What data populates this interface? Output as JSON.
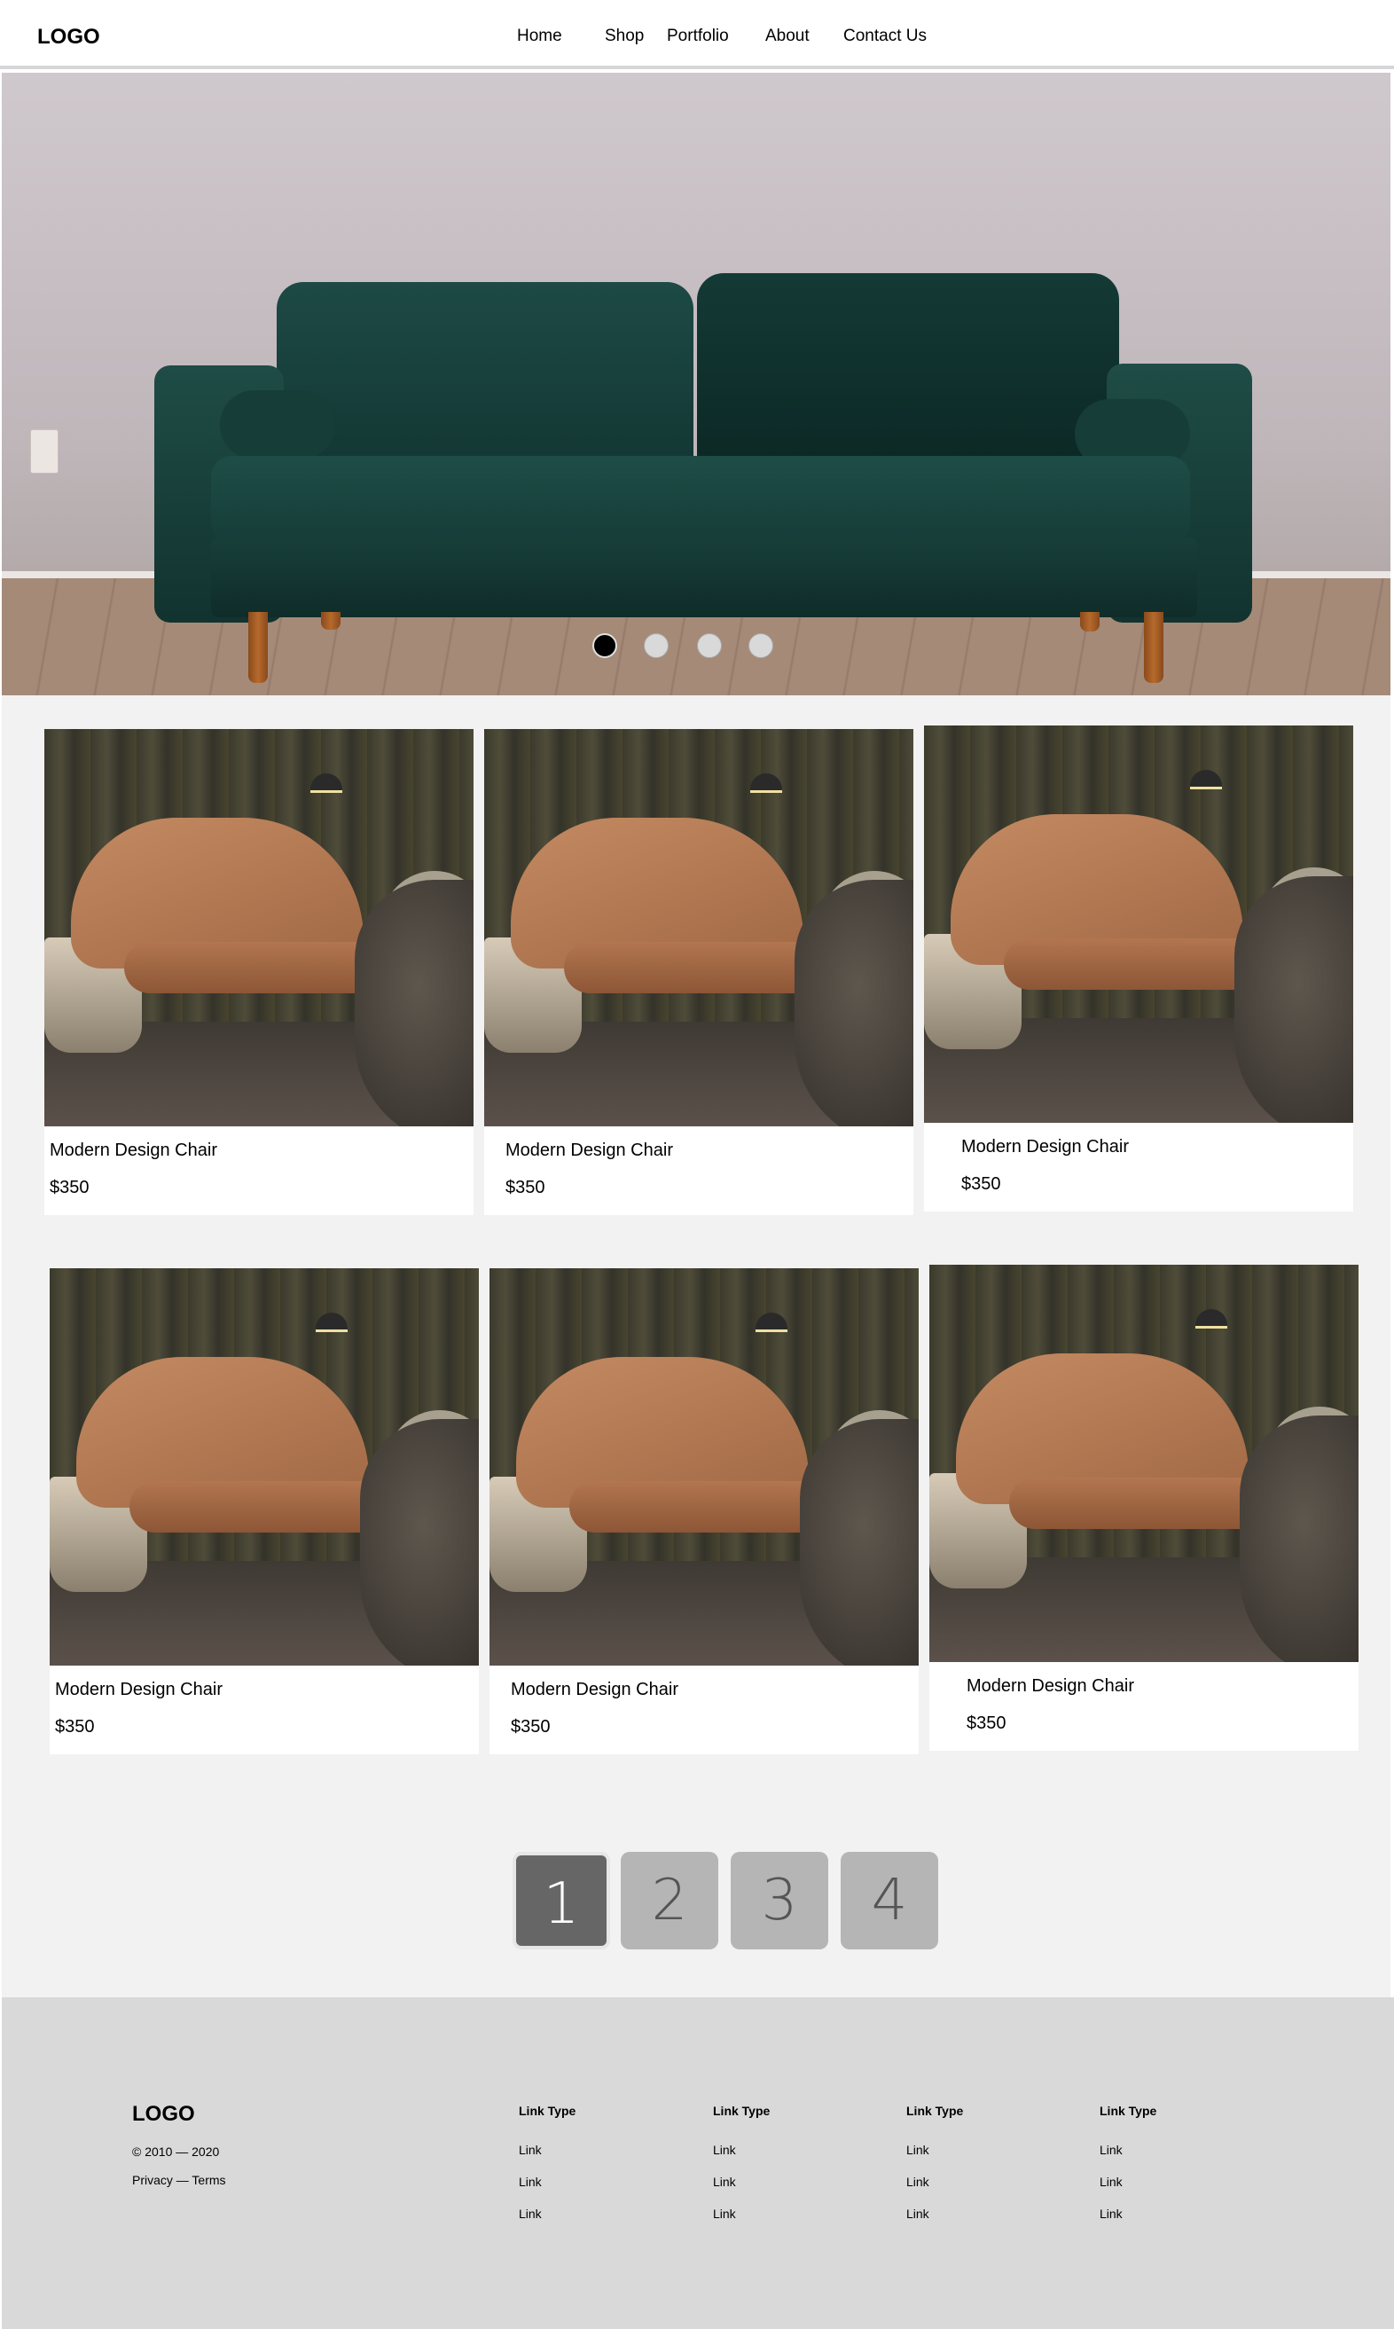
{
  "header": {
    "logo": "LOGO",
    "nav": [
      "Home",
      "Shop",
      "Portfolio",
      "About",
      "Contact Us"
    ]
  },
  "hero": {
    "slides": 4,
    "active_slide": 1
  },
  "products": [
    {
      "name": "Modern Design Chair",
      "price": "$350"
    },
    {
      "name": "Modern Design Chair",
      "price": "$350"
    },
    {
      "name": "Modern Design Chair",
      "price": "$350"
    },
    {
      "name": "Modern Design Chair",
      "price": "$350"
    },
    {
      "name": "Modern Design Chair",
      "price": "$350"
    },
    {
      "name": "Modern Design Chair",
      "price": "$350"
    }
  ],
  "pagination": {
    "pages": [
      "1",
      "2",
      "3",
      "4"
    ],
    "current": "1"
  },
  "footer": {
    "logo": "LOGO",
    "copyright": "© 2010 — 2020",
    "legal": "Privacy — Terms",
    "columns": [
      {
        "title": "Link Type",
        "links": [
          "Link",
          "Link",
          "Link"
        ]
      },
      {
        "title": "Link Type",
        "links": [
          "Link",
          "Link",
          "Link"
        ]
      },
      {
        "title": "Link Type",
        "links": [
          "Link",
          "Link",
          "Link"
        ]
      },
      {
        "title": "Link Type",
        "links": [
          "Link",
          "Link",
          "Link"
        ]
      }
    ]
  },
  "colors": {
    "page_bg": "#f2f2f2",
    "footer_bg": "#d9d9d9",
    "pagination_active": "#666666",
    "pagination_inactive": "#b5b5b5"
  }
}
